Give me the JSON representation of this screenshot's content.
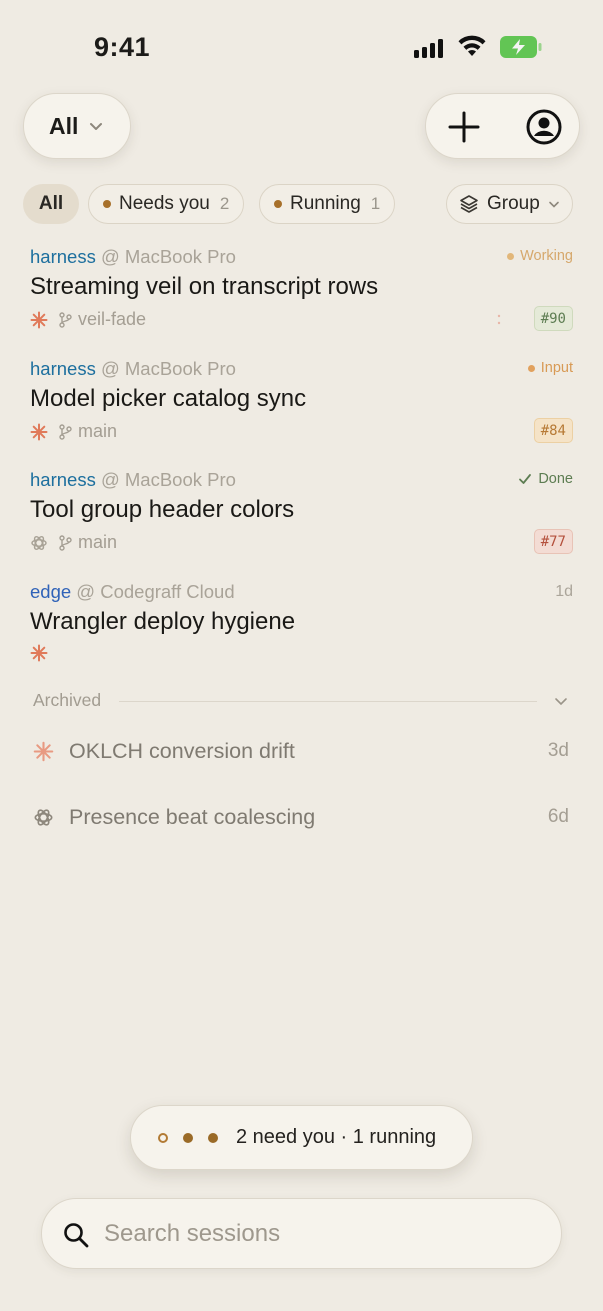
{
  "status_bar": {
    "time": "9:41"
  },
  "header": {
    "scope_label": "All",
    "icons": {
      "scope": "chevron-down-icon",
      "new": "plus-icon",
      "account": "profile-icon"
    }
  },
  "filters": {
    "all": "All",
    "needs_you": {
      "label": "Needs you",
      "count": "2"
    },
    "running": {
      "label": "Running",
      "count": "1"
    },
    "group": "Group"
  },
  "sessions": [
    {
      "repo": "harness",
      "at": "@",
      "host": "MacBook Pro",
      "title": "Streaming veil on transcript rows",
      "agent_icon": "claude-icon",
      "branch": "veil-fade",
      "status": "Working",
      "pr": "#90"
    },
    {
      "repo": "harness",
      "at": "@",
      "host": "MacBook Pro",
      "title": "Model picker catalog sync",
      "agent_icon": "claude-icon",
      "branch": "main",
      "status": "Input",
      "pr": "#84"
    },
    {
      "repo": "harness",
      "at": "@",
      "host": "MacBook Pro",
      "title": "Tool group header colors",
      "agent_icon": "openai-icon",
      "branch": "main",
      "status": "Done",
      "pr": "#77"
    },
    {
      "repo": "edge",
      "at": "@",
      "host": "Codegraff Cloud",
      "title": "Wrangler deploy hygiene",
      "agent_icon": "claude-icon",
      "ago": "1d"
    }
  ],
  "archived": {
    "label": "Archived",
    "items": [
      {
        "title": "OKLCH conversion drift",
        "ago": "3d",
        "agent_icon": "claude-icon"
      },
      {
        "title": "Presence beat coalescing",
        "ago": "6d",
        "agent_icon": "openai-icon"
      }
    ]
  },
  "summary": {
    "text": "2 need you · 1 running"
  },
  "search": {
    "placeholder": "Search sessions"
  },
  "colors": {
    "background": "#efebe3",
    "accent": "#a7702a",
    "claude": "#e07a5a",
    "done": "#5d7d52"
  }
}
